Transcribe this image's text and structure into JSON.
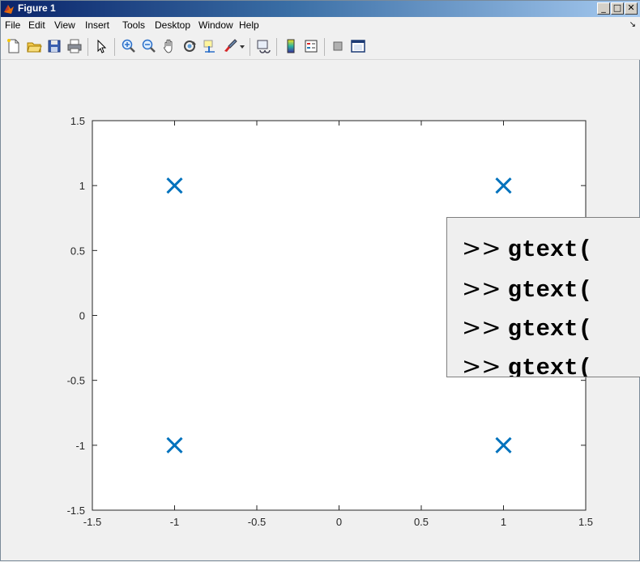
{
  "window": {
    "title": "Figure 1",
    "buttons": {
      "minimize": "_",
      "maximize": "□",
      "close": "✕"
    }
  },
  "menubar": {
    "items": [
      "File",
      "Edit",
      "View",
      "Insert",
      "Tools",
      "Desktop",
      "Window",
      "Help"
    ],
    "arrow": "↘"
  },
  "toolbar": {
    "icons": [
      "new-figure-icon",
      "open-file-icon",
      "save-icon",
      "print-icon",
      "pointer-icon",
      "zoom-in-icon",
      "zoom-out-icon",
      "pan-icon",
      "rotate-3d-icon",
      "data-cursor-icon",
      "brush-icon",
      "link-plot-icon",
      "colorbar-icon",
      "legend-icon",
      "hide-plot-tools-icon",
      "show-plot-tools-icon"
    ]
  },
  "chart_data": {
    "type": "scatter",
    "marker": "x",
    "color": "#0072bd",
    "x": [
      -1,
      1,
      -1,
      1
    ],
    "y": [
      1,
      1,
      -1,
      -1
    ],
    "xlim": [
      -1.5,
      1.5
    ],
    "ylim": [
      -1.5,
      1.5
    ],
    "xticks": [
      "-1.5",
      "-1",
      "-0.5",
      "0",
      "0.5",
      "1",
      "1.5"
    ],
    "yticks": [
      "-1.5",
      "-1",
      "-0.5",
      "0",
      "0.5",
      "1",
      "1.5"
    ],
    "grid": false
  },
  "overlay": {
    "lines": [
      {
        "prompt": ">>",
        "code": "gtext("
      },
      {
        "prompt": ">>",
        "code": "gtext("
      },
      {
        "prompt": ">>",
        "code": "gtext("
      },
      {
        "prompt": ">>",
        "code": "gtext("
      }
    ]
  }
}
